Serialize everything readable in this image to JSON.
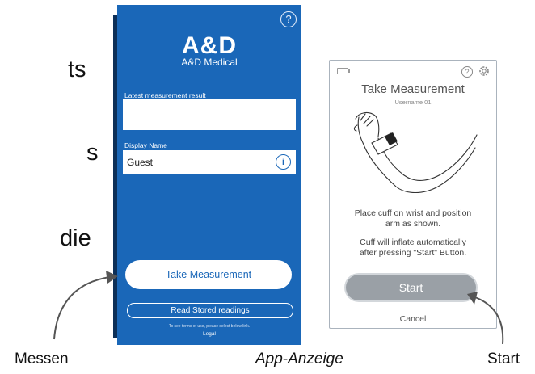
{
  "left_text": [
    "ts",
    "s",
    "die"
  ],
  "captions": {
    "messen": "Messen",
    "app_anzeige": "App-Anzeige",
    "start": "Start"
  },
  "home_screen": {
    "help_icon": "?",
    "logo": "A&D",
    "brand": "A&D Medical",
    "latest_label": "Latest measurement result",
    "latest_value": "",
    "display_name_label": "Display Name",
    "display_name_value": "Guest",
    "info_icon": "i",
    "take_measurement": "Take Measurement",
    "read_stored": "Read Stored readings",
    "terms_note": "To see terms of use, please select below link.",
    "legal": "Legal",
    "colors": {
      "background": "#1a67b8",
      "button": "#ffffff"
    }
  },
  "measure_screen": {
    "help_icon": "?",
    "title": "Take Measurement",
    "username": "Username 01",
    "instruction_1": [
      "Place cuff on wrist and position",
      "arm as shown."
    ],
    "instruction_2": [
      "Cuff will inflate automatically",
      "after pressing \"Start\" Button."
    ],
    "start": "Start",
    "cancel": "Cancel",
    "colors": {
      "start_button": "#9aa0a6"
    }
  }
}
